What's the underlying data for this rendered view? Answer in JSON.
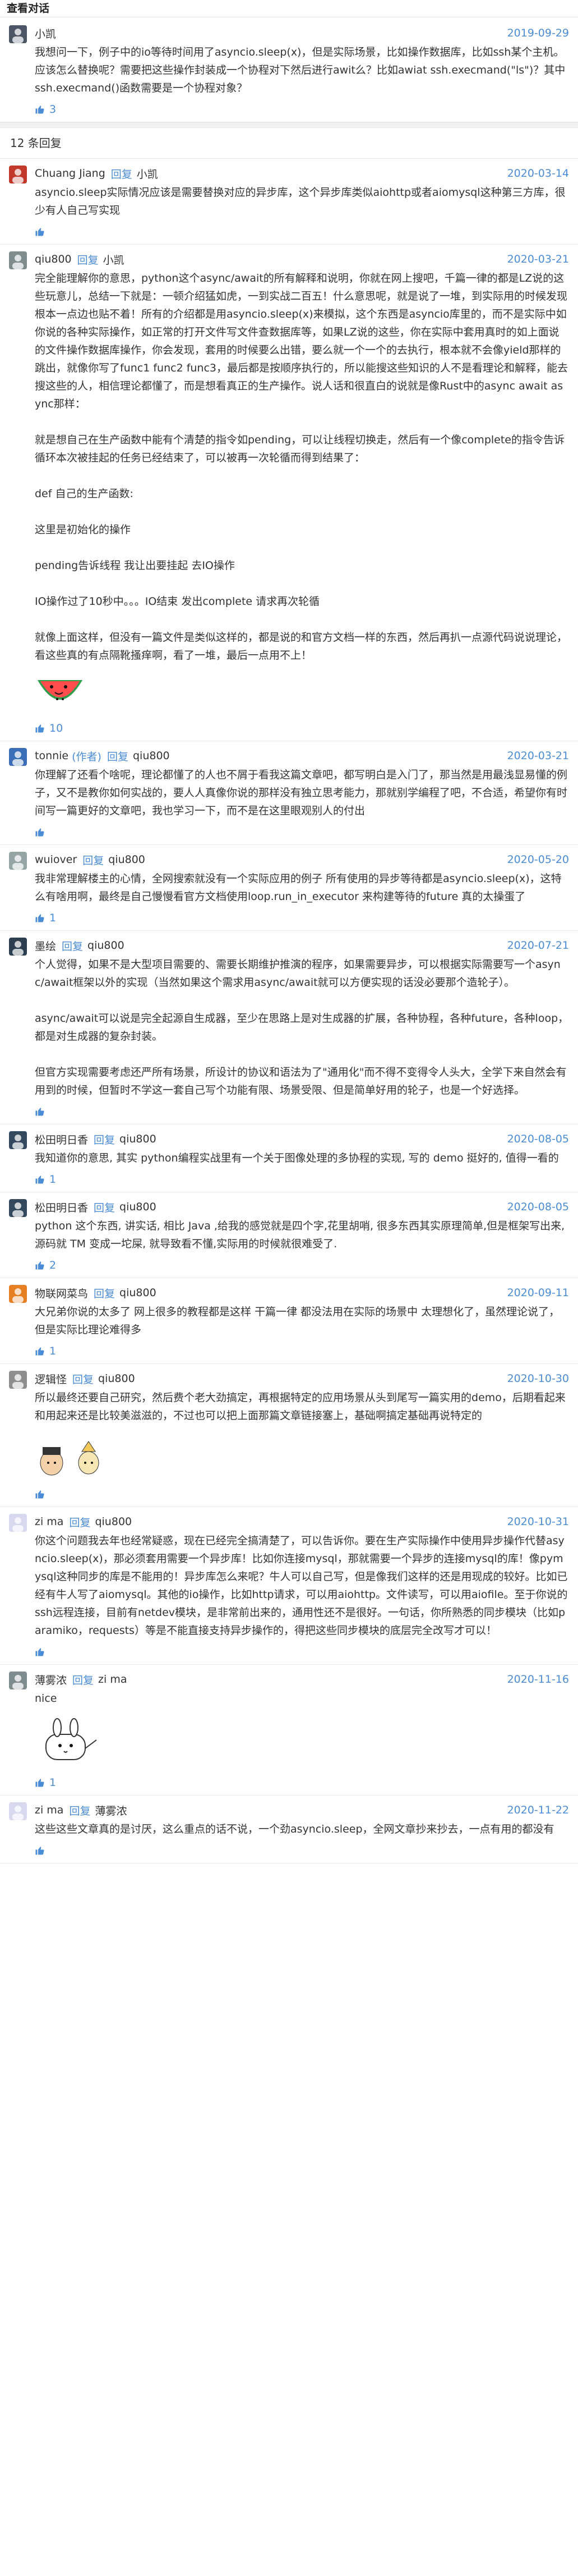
{
  "page_title": "查看对话",
  "original": {
    "author": "小凯",
    "date": "2019-09-29",
    "text": "我想问一下，例子中的io等待时间用了asyncio.sleep(x)，但是实际场景，比如操作数据库，比如ssh某个主机。应该怎么替换呢？需要把这些操作封装成一个协程对下然后进行awit么？比如awiat ssh.execmand(\"ls\")？其中ssh.execmand()函数需要是一个协程对象？",
    "likes": "3"
  },
  "reply_count": "12 条回复",
  "labels": {
    "reply": "回复",
    "author_tag": "(作者)"
  },
  "comments": [
    {
      "author": "Chuang Jiang",
      "target": "小凯",
      "date": "2020-03-14",
      "likes": "",
      "color": "#c0392b",
      "paragraphs": [
        "asyncio.sleep实际情况应该是需要替换对应的异步库，这个异步库类似aiohttp或者aiomysql这种第三方库，很少有人自己写实现"
      ]
    },
    {
      "author": "qiu800",
      "target": "小凯",
      "date": "2020-03-21",
      "likes": "10",
      "color": "#7f8c8d",
      "paragraphs": [
        "完全能理解你的意思，python这个async/await的所有解释和说明，你就在网上搜吧，千篇一律的都是LZ说的这些玩意儿，总结一下就是：一顿介绍猛如虎，一到实战二百五！什么意思呢，就是说了一堆，到实际用的时候发现根本一点边也贴不着！所有的介绍都是用asyncio.sleep(x)来模拟，这个东西是asyncio库里的，而不是实际中如你说的各种实际操作，如正常的打开文件写文件查数据库等，如果LZ说的这些，你在实际中套用真时的如上面说的文件操作数据库操作，你会发现，套用的时候要么出错，要么就一个一个的去执行，根本就不会像yield那样的跳出，就像你写了func1 func2 func3，最后都是按顺序执行的，所以能搜这些知识的人不是看理论和解释，能去搜这些的人，相信理论都懂了，而是想看真正的生产操作。说人话和很直白的说就是像Rust中的async await async那样：",
        "就是想自己在生产函数中能有个清楚的指令如pending，可以让线程切换走，然后有一个像complete的指令告诉循环本次被挂起的任务已经结束了，可以被再一次轮循而得到结果了：",
        "def 自己的生产函数:",
        "这里是初始化的操作",
        "pending告诉线程 我让出要挂起 去IO操作",
        "IO操作过了10秒中。。。IO结束 发出complete 请求再次轮循",
        "就像上面这样，但没有一篇文件是类似这样的，都是说的和官方文档一样的东西，然后再扒一点源代码说说理论，看这些真的有点隔靴搔痒啊，看了一堆，最后一点用不上！"
      ],
      "has_watermelon": true
    },
    {
      "author": "tonnie",
      "is_author": true,
      "target": "qiu800",
      "date": "2020-03-21",
      "likes": "",
      "color": "#3a6fb8",
      "paragraphs": [
        "你理解了还看个啥呢，理论都懂了的人也不屑于看我这篇文章吧，都写明白是入门了，那当然是用最浅显易懂的例子，又不是教你如何实战的，要人人真像你说的那样没有独立思考能力，那就别学编程了吧，不合适，希望你有时间写一篇更好的文章吧，我也学习一下，而不是在这里眼观别人的付出"
      ]
    },
    {
      "author": "wuiover",
      "target": "qiu800",
      "date": "2020-05-20",
      "likes": "1",
      "color": "#95a5a6",
      "paragraphs": [
        "我非常理解楼主的心情，全网搜索就没有一个实际应用的例子 所有使用的异步等待都是asyncio.sleep(x)，这特么有啥用啊，最终是自己慢慢看官方文档使用loop.run_in_executor 来构建等待的future 真的太操蛋了"
      ]
    },
    {
      "author": "墨绘",
      "target": "qiu800",
      "date": "2020-07-21",
      "likes": "",
      "color": "#2c3e50",
      "paragraphs": [
        "个人觉得，如果不是大型项目需要的、需要长期维护推演的程序，如果需要异步，可以根据实际需要写一个async/await框架以外的实现（当然如果这个需求用async/await就可以方便实现的话没必要那个造轮子）。",
        "async/await可以说是完全起源自生成器，至少在思路上是对生成器的扩展，各种协程，各种future，各种loop，都是对生成器的复杂封装。",
        "但官方实现需要考虑还严所有场景，所设计的协议和语法为了\"通用化\"而不得不变得令人头大，全学下来自然会有用到的时候，但暂时不学这一套自己写个功能有限、场景受限、但是简单好用的轮子，也是一个好选择。"
      ]
    },
    {
      "author": "松田明日香",
      "target": "qiu800",
      "date": "2020-08-05",
      "likes": "1",
      "color": "#34495e",
      "paragraphs": [
        "我知道你的意思, 其实 python编程实战里有一个关于图像处理的多协程的实现, 写的 demo 挺好的, 值得一看的"
      ]
    },
    {
      "author": "松田明日香",
      "target": "qiu800",
      "date": "2020-08-05",
      "likes": "2",
      "color": "#34495e",
      "paragraphs": [
        "python 这个东西, 讲实话, 相比 Java ,给我的感觉就是四个字,花里胡哨, 很多东西其实原理简单,但是框架写出来, 源码就 TM 变成一坨屎, 就导致看不懂,实际用的时候就很难受了."
      ]
    },
    {
      "author": "物联网菜鸟",
      "target": "qiu800",
      "date": "2020-09-11",
      "likes": "1",
      "color": "#e67e22",
      "paragraphs": [
        "大兄弟你说的太多了 网上很多的教程都是这样 干篇一律 都没法用在实际的场景中 太理想化了，虽然理论说了，但是实际比理论难得多"
      ]
    },
    {
      "author": "逻辑怪",
      "target": "qiu800",
      "date": "2020-10-30",
      "likes": "",
      "color": "#8e8e8e",
      "paragraphs": [
        "所以最终还要自己研究，然后费个老大劲搞定，再根据特定的应用场景从头到尾写一篇实用的demo，后期看起来和用起来还是比较美滋滋的，不过也可以把上面那篇文章链接塞上，基础啊搞定基础再说特定的"
      ],
      "has_stickers": true
    },
    {
      "author": "zi ma",
      "target": "qiu800",
      "date": "2020-10-31",
      "likes": "",
      "color": "#d8d8ee",
      "paragraphs": [
        "你这个问题我去年也经常疑惑，现在已经完全搞清楚了，可以告诉你。要在生产实际操作中使用异步操作代替asyncio.sleep(x)，那必须套用需要一个异步库！比如你连接mysql，那就需要一个异步的连接mysql的库！像pymysql这种同步的库是不能用的！异步库怎么来呢？牛人可以自己写，但是像我们这样的还是用现成的较好。比如已经有牛人写了aiomysql。其他的io操作，比如http请求，可以用aiohttp。文件读写，可以用aiofile。至于你说的ssh远程连接，目前有netdev模块，是非常前出来的，通用性还不是很好。一句话，你所熟悉的同步模块（比如paramiko，requests）等是不能直接支持异步操作的，得把这些同步模块的底层完全改写才可以！"
      ]
    },
    {
      "author": "薄雾浓",
      "target": "zi ma",
      "date": "2020-11-16",
      "likes": "1",
      "color": "#7f8c8d",
      "paragraphs": [
        "nice"
      ],
      "has_bunny": true
    },
    {
      "author": "zi ma",
      "target": "薄雾浓",
      "date": "2020-11-22",
      "likes": "",
      "color": "#d8d8ee",
      "paragraphs": [
        "这些这些文章真的是讨厌，这么重点的话不说，一个劲asyncio.sleep，全网文章抄来抄去，一点有用的都没有"
      ]
    }
  ]
}
